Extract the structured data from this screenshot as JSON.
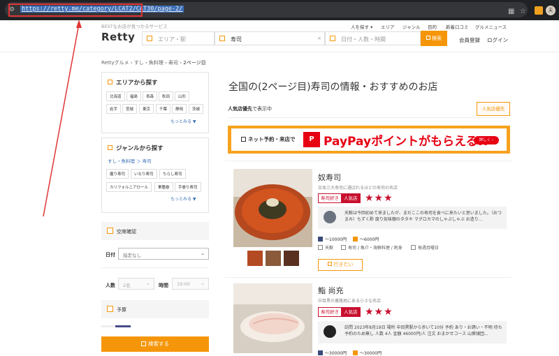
{
  "browser": {
    "url": "https://retty.me/category/LCAT2/CAT30/page-2/",
    "avatar": "天"
  },
  "header": {
    "tagline": "BESTなお店が見つかるサービス",
    "logo": "Retty",
    "top_nav": [
      "人を探す ▾",
      "エリア",
      "ジャンル",
      "目的",
      "新着口コミ",
      "グルメニュース"
    ],
    "area_placeholder": "エリア・駅",
    "keyword_value": "寿司",
    "clear_label": "×",
    "date_placeholder": "日付・人数・時間",
    "search_label": "検索",
    "signup_label": "会員登録",
    "login_label": "ログイン"
  },
  "breadcrumb": [
    "Rettyグルメ",
    "すし・魚料理",
    "寿司",
    "2ページ目"
  ],
  "sidebar": {
    "area_title": "エリアから探す",
    "area_chips": [
      [
        "北海道",
        "福島",
        "青森",
        "秋田",
        "山形"
      ],
      [
        "岩手",
        "宮城",
        "東京",
        "千葉",
        "静岡",
        "茨城"
      ]
    ],
    "area_more": "もっとみる ▼",
    "genre_title": "ジャンルから探す",
    "genre_path": "すし・魚料理 ＞ 寿司",
    "genre_chips": [
      [
        "握り寿司",
        "いなり寿司",
        "ちらし寿司"
      ],
      [
        "カリフォルニアロール",
        "軍艦巻",
        "手巻り寿司"
      ]
    ],
    "genre_more": "もっとみる ▼",
    "vacancy_label": "空席確認",
    "date_label": "日付",
    "date_value": "指定なし",
    "people_label": "人数",
    "people_value": "2名",
    "time_label": "時間",
    "time_value": "19:00",
    "budget_label": "予算",
    "search_button": "検索する"
  },
  "main": {
    "heading": "全国の(2ページ目)寿司の情報・おすすめのお店",
    "sort_label_bold": "人気店優先",
    "sort_label_rest": "で表示中",
    "sort_button": "人気店優先",
    "banner": {
      "left_text": "ネット予約・来店で",
      "logo_text": "P",
      "main_text": "PayPayポイントがもらえる!!",
      "detail_button": "詳しく ›"
    },
    "restaurants": [
      {
        "name": "奴寿司",
        "subtitle": "日本三大寿司に選ばれるほどの寿司の名店",
        "tag_fan": "寿司好き",
        "tag_popular": "人気店",
        "stars": "★★★",
        "review": "天麩は今回初めて来ましたが、まだここの寿司を食べに来たいと思いました。（おつまみ）もずく酢 度り気味棚のタタキ マグロカマのしゃぶしゃぶ お造り...",
        "price_dinner": "～10000円",
        "price_lunch": "～6000円",
        "station": "天麩",
        "genre": "寿司 / 魚介・海鮮料理 / 刺身",
        "holiday": "毎週月曜日",
        "want_button": "行きたい"
      },
      {
        "name": "鮨 尚充",
        "subtitle": "中目黒の裏路地にある小さな名店",
        "tag_fan": "寿司好き",
        "tag_popular": "人気店",
        "stars": "★★★",
        "review": "訪問 2023年8月19日 場所 中目黒駅から歩いて10分 予約 あり・お誘い・不明 待ち 予約のため無し 人数 4人 金額 46000円/人 注文 おまかせコース 山葵頭団...",
        "price_dinner": "～30000円",
        "price_lunch": "～30000円"
      }
    ]
  }
}
